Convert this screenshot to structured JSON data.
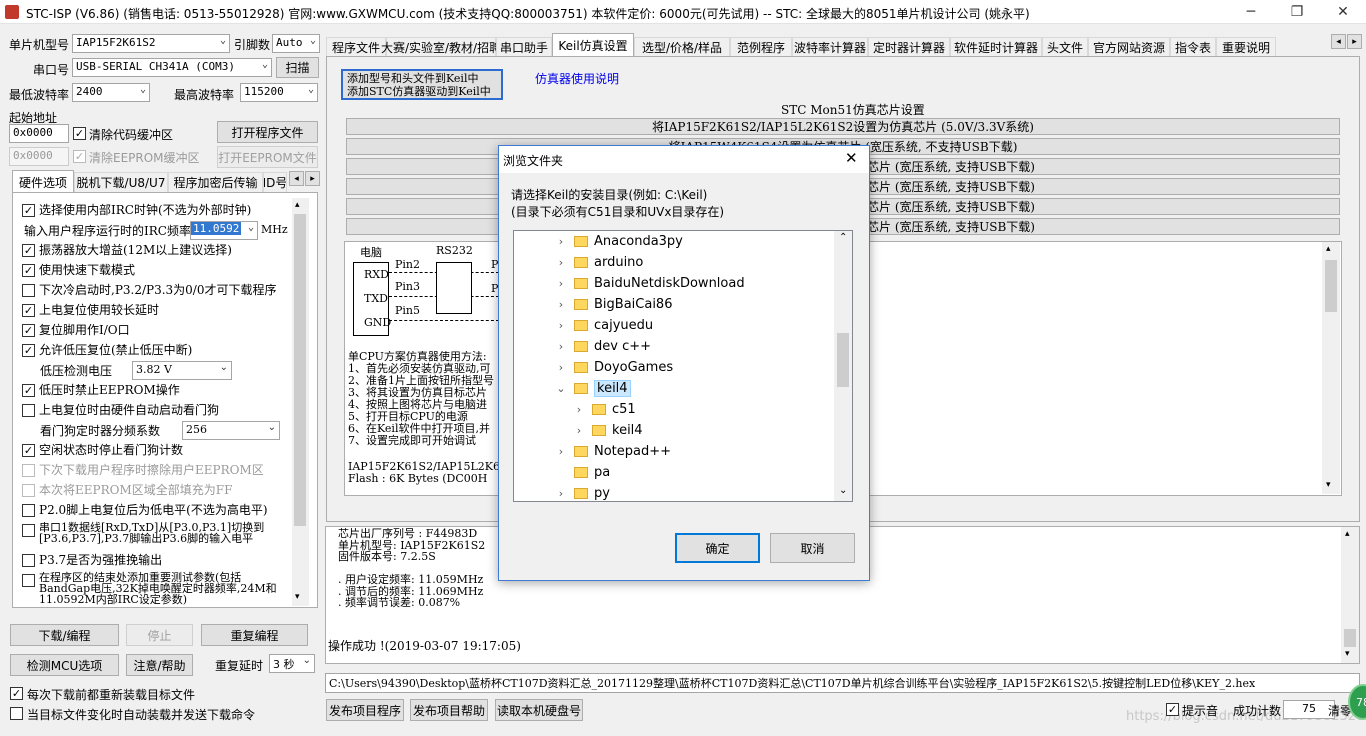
{
  "window": {
    "title": "STC-ISP (V6.86) (销售电话: 0513-55012928) 官网:www.GXWMCU.com  (技术支持QQ:800003751) 本软件定价: 6000元(可先试用) -- STC: 全球最大的8051单片机设计公司 (姚永平)",
    "min": "─",
    "max": "❐",
    "close": "✕"
  },
  "left": {
    "mcu_label": "单片机型号",
    "mcu_value": "IAP15F2K61S2",
    "pins_label": "引脚数",
    "pins_value": "Auto",
    "port_label": "串口号",
    "port_value": "USB-SERIAL CH341A (COM3)",
    "scan": "扫描",
    "min_baud_label": "最低波特率",
    "min_baud_value": "2400",
    "max_baud_label": "最高波特率",
    "max_baud_value": "115200",
    "start_addr_label": "起始地址",
    "addr1": "0x0000",
    "clear_code": "清除代码缓冲区",
    "open_prog": "打开程序文件",
    "addr2": "0x0000",
    "clear_eeprom": "清除EEPROM缓冲区",
    "open_eeprom": "打开EEPROM文件",
    "tabs": [
      "硬件选项",
      "脱机下载/U8/U7",
      "程序加密后传输",
      "ID号"
    ],
    "options": [
      {
        "checked": true,
        "text": "选择使用内部IRC时钟(不选为外部时钟)",
        "dis": false
      },
      {
        "checked": true,
        "text": "振荡器放大增益(12M以上建议选择)",
        "dis": false
      },
      {
        "checked": true,
        "text": "使用快速下载模式",
        "dis": false
      },
      {
        "checked": false,
        "text": "下次冷启动时,P3.2/P3.3为0/0才可下载程序",
        "dis": false
      },
      {
        "checked": true,
        "text": "上电复位使用较长延时",
        "dis": false
      },
      {
        "checked": true,
        "text": "复位脚用作I/O口",
        "dis": false
      },
      {
        "checked": true,
        "text": "允许低压复位(禁止低压中断)",
        "dis": false
      },
      {
        "checked": true,
        "text": "低压时禁止EEPROM操作",
        "dis": false
      },
      {
        "checked": false,
        "text": "上电复位时由硬件自动启动看门狗",
        "dis": false
      },
      {
        "checked": true,
        "text": "空闲状态时停止看门狗计数",
        "dis": false
      },
      {
        "checked": false,
        "text": "下次下载用户程序时擦除用户EEPROM区",
        "dis": true
      },
      {
        "checked": false,
        "text": "本次将EEPROM区域全部填充为FF",
        "dis": true
      },
      {
        "checked": false,
        "text": "P2.0脚上电复位后为低电平(不选为高电平)",
        "dis": false
      },
      {
        "checked": false,
        "text": "串口1数据线[RxD,TxD]从[P3.0,P3.1]切换到[P3.6,P3.7],P3.7脚输出P3.6脚的输入电平",
        "dis": false
      },
      {
        "checked": false,
        "text": "P3.7是否为强推挽输出",
        "dis": false
      },
      {
        "checked": false,
        "text": "在程序区的结束处添加重要测试参数(包括BandGap电压,32K掉电唤醒定时器频率,24M和11.0592M内部IRC设定参数)",
        "dis": false
      }
    ],
    "irc_label": "输入用户程序运行时的IRC频率",
    "irc_value": "11.0592",
    "irc_unit": "MHz",
    "lv_label": "低压检测电压",
    "lv_value": "3.82 V",
    "wdt_label": "看门狗定时器分频系数",
    "wdt_value": "256",
    "download": "下载/编程",
    "stop": "停止",
    "reprogram": "重复编程",
    "detect": "检测MCU选项",
    "help": "注意/帮助",
    "repeat_delay_label": "重复延时",
    "repeat_delay_value": "3 秒",
    "reload_each": "每次下载前都重新装载目标文件",
    "auto_send": "当目标文件变化时自动装载并发送下载命令"
  },
  "right": {
    "tabs": [
      "程序文件",
      "大赛/实验室/教材/招聘",
      "串口助手",
      "Keil仿真设置",
      "选型/价格/样品",
      "范例程序",
      "波特率计算器",
      "定时器计算器",
      "软件延时计算器",
      "头文件",
      "官方网站资源",
      "指令表",
      "重要说明"
    ],
    "add_btn_line1": "添加型号和头文件到Keil中",
    "add_btn_line2": "添加STC仿真器驱动到Keil中",
    "emu_link": "仿真器使用说明",
    "mon51_title": "STC Mon51仿真芯片设置",
    "chip_rows": [
      "将IAP15F2K61S2/IAP15L2K61S2设置为仿真芯片 (5.0V/3.3V系统)",
      "将IAP15W4K61S4设置为仿真芯片 (宽压系统, 不支持USB下载)",
      "芯片 (宽压系统, 支持USB下载)",
      "芯片 (宽压系统, 支持USB下载)",
      "芯片 (宽压系统, 支持USB下载)",
      "芯片 (宽压系统, 支持USB下载)"
    ],
    "diagram": {
      "pc": "电脑",
      "rs232": "RS232",
      "rxd": "RXD",
      "txd": "TXD",
      "gnd": "GND",
      "pin2": "Pin2",
      "pin3": "Pin3",
      "pin5": "Pin5",
      "p": "P"
    },
    "usage_lines": [
      "单CPU方案仿真器使用方法:",
      "1、首先必须安装仿真驱动,可",
      "2、准备1片上面按钮所指型号",
      "3、将其设置为仿真目标芯片",
      "4、按照上图将芯片与电脑进",
      "5、打开目标CPU的电源",
      "6、在Keil软件中打开项目,并",
      "7、设置完成即可开始调试"
    ],
    "chip_info_line1": "IAP15F2K61S2/IAP15L2K61S2",
    "chip_info_line2": "Flash : 6K Bytes    (DC00H",
    "log_lines": [
      "  芯片出厂序列号 : F44983D",
      "  单片机型号: IAP15F2K61S2",
      "  固件版本号: 7.2.5S",
      "",
      ". 用户设定频率: 11.059MHz",
      ". 调节后的频率: 11.069MHz",
      ". 频率调节误差: 0.087%"
    ],
    "log_success": "操作成功 !(2019-03-07 19:17:05)",
    "path": "C:\\Users\\94390\\Desktop\\蓝桥杯CT107D资料汇总_20171129整理\\蓝桥杯CT107D资料汇总\\CT107D单片机综合训练平台\\实验程序_IAP15F2K61S2\\5.按键控制LED位移\\KEY_2.hex",
    "publish_prog": "发布项目程序",
    "publish_help": "发布项目帮助",
    "read_disk": "读取本机硬盘号",
    "beep": "提示音",
    "success_count_label": "成功计数",
    "success_count": "75",
    "clear": "清零",
    "watermark": "https://blog.csdn.net/du2179382320",
    "badge": "78"
  },
  "dialog": {
    "title": "浏览文件夹",
    "close": "✕",
    "desc1": "请选择Keil的安装目录(例如: C:\\Keil)",
    "desc2": "(目录下必须有C51目录和UVx目录存在)",
    "ok": "确定",
    "cancel": "取消",
    "tree": [
      {
        "name": "Anaconda3py",
        "level": 0,
        "chev": "›"
      },
      {
        "name": "arduino",
        "level": 0,
        "chev": "›"
      },
      {
        "name": "BaiduNetdiskDownload",
        "level": 0,
        "chev": "›"
      },
      {
        "name": "BigBaiCai86",
        "level": 0,
        "chev": "›"
      },
      {
        "name": "cajyuedu",
        "level": 0,
        "chev": "›"
      },
      {
        "name": "dev c++",
        "level": 0,
        "chev": "›"
      },
      {
        "name": "DoyoGames",
        "level": 0,
        "chev": "›"
      },
      {
        "name": "keil4",
        "level": 0,
        "chev": "⌄",
        "selected": true
      },
      {
        "name": "c51",
        "level": 1,
        "chev": "›"
      },
      {
        "name": "keil4",
        "level": 1,
        "chev": "›"
      },
      {
        "name": "Notepad++",
        "level": 0,
        "chev": "›"
      },
      {
        "name": "pa",
        "level": 0,
        "chev": ""
      },
      {
        "name": "py",
        "level": 0,
        "chev": "›"
      }
    ]
  }
}
